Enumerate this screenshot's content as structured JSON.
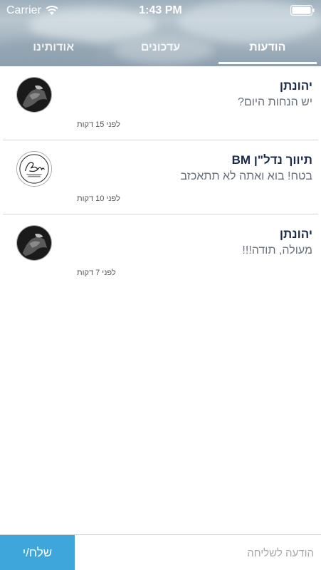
{
  "status_bar": {
    "carrier": "Carrier",
    "time": "1:43 PM"
  },
  "tabs": [
    {
      "label": "אודותינו",
      "active": false
    },
    {
      "label": "עדכונים",
      "active": false
    },
    {
      "label": "הודעות",
      "active": true
    }
  ],
  "messages": [
    {
      "sender": "יהונתן",
      "text": "יש הנחות היום?",
      "time": "לפני 15 דקות",
      "avatar": "dark-photo-avatar"
    },
    {
      "sender": "תיווך נדל\"ן BM",
      "text": "בטח! בוא ואתה לא תתאכזב",
      "time": "לפני 10 דקות",
      "avatar": "bm-logo-avatar"
    },
    {
      "sender": "יהונתן",
      "text": "מעולה, תודה!!!",
      "time": "לפני 7 דקות",
      "avatar": "dark-photo-avatar"
    }
  ],
  "composer": {
    "placeholder": "הודעה לשליחה",
    "send_label": "שלח/י"
  },
  "colors": {
    "accent": "#3fa6dc",
    "sender_name": "#1b2a4a"
  }
}
